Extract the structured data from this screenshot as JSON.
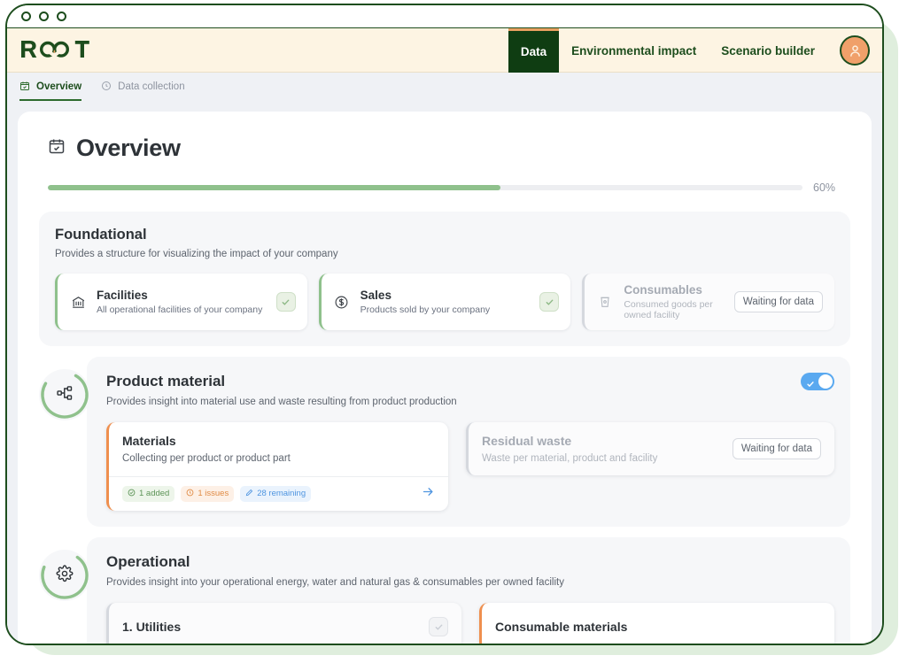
{
  "window": {
    "dots": [
      "window-dot-1",
      "window-dot-2",
      "window-dot-3"
    ]
  },
  "header": {
    "logo_text": "ROOT",
    "nav": [
      {
        "label": "Data",
        "active": true
      },
      {
        "label": "Environmental impact",
        "active": false
      },
      {
        "label": "Scenario builder",
        "active": false
      }
    ],
    "avatar_icon": "user-avatar-icon"
  },
  "subnav": {
    "items": [
      {
        "label": "Overview",
        "icon": "calendar-check-icon",
        "active": true
      },
      {
        "label": "Data collection",
        "icon": "clock-icon",
        "active": false
      }
    ]
  },
  "page": {
    "title": "Overview",
    "title_icon": "calendar-check-icon",
    "progress": {
      "percent_label": "60%",
      "percent_value": 60,
      "fill_color": "#8fc18c",
      "track_color": "#edeef1"
    }
  },
  "foundational": {
    "title": "Foundational",
    "subtitle": "Provides a structure for visualizing the impact of your company",
    "cards": [
      {
        "title": "Facilities",
        "subtitle": "All operational facilities of your company",
        "icon": "bank-icon",
        "state": "complete",
        "badge": "check-badge",
        "accent": "#8fc18c"
      },
      {
        "title": "Sales",
        "subtitle": "Products sold by your company",
        "icon": "dollar-circle-icon",
        "state": "complete",
        "badge": "check-badge",
        "accent": "#8fc18c"
      },
      {
        "title": "Consumables",
        "subtitle": "Consumed goods per owned facility",
        "icon": "cup-icon",
        "state": "waiting",
        "button_label": "Waiting for data",
        "accent": "#d5d8de"
      }
    ]
  },
  "product_material": {
    "title": "Product material",
    "subtitle": "Provides insight into material use and waste resulting from product production",
    "ring_icon": "hierarchy-icon",
    "toggle": {
      "on": true,
      "color": "#5aa9f0",
      "name": "product-material-toggle"
    },
    "cards": [
      {
        "title": "Materials",
        "subtitle": "Collecting per product or product part",
        "state": "active",
        "accent": "#ef8f4e",
        "chips": [
          {
            "label": "1 added",
            "icon": "check-circle-icon",
            "tone": "green"
          },
          {
            "label": "1 issues",
            "icon": "alert-circle-icon",
            "tone": "orange"
          },
          {
            "label": "28 remaining",
            "icon": "pencil-icon",
            "tone": "blue"
          }
        ],
        "arrow_icon": "arrow-right-icon"
      },
      {
        "title": "Residual waste",
        "subtitle": "Waste per material, product and facility",
        "state": "waiting",
        "accent": "#d5d8de",
        "button_label": "Waiting for data"
      }
    ]
  },
  "operational": {
    "title": "Operational",
    "subtitle": "Provides insight into your operational energy, water and natural gas & consumables per owned facility",
    "ring_icon": "gear-icon",
    "cards": [
      {
        "title": "1. Utilities",
        "accent": "#d5d8de"
      },
      {
        "title": "Consumable materials",
        "accent": "#ef8f4e"
      }
    ]
  }
}
